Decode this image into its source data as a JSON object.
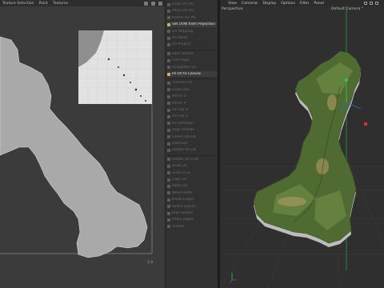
{
  "uv_editor": {
    "menu": [
      "Texture Selection",
      "Paint",
      "Textures"
    ],
    "axis_max_label": "1.0"
  },
  "commands": {
    "active_items": [
      {
        "label": "Set UVW from Projection"
      },
      {
        "label": "Fit UV to Canvas"
      }
    ],
    "dim_items": [
      "Scale UV Pts",
      "Move UV Pts",
      "Rotate UV Pts",
      "UV Mapping",
      "UV Relax",
      "UV Project",
      "Pack Islands",
      "Grid Align",
      "Straighten UV",
      "Transfer UV",
      "Scale UVs",
      "Mirror U",
      "Mirror V",
      "UV Flip U",
      "UV Flip V",
      "Fit Selection",
      "Align Islands",
      "Orient Islands",
      "Optimize",
      "Rotate 90 CW",
      "Rotate 90 CCW",
      "Scale 2x",
      "Scale 0.5x",
      "Copy UV",
      "Paste UV",
      "Weld Points",
      "Break Edges",
      "Select Seams",
      "Hide Seams",
      "Relax Edges",
      "Unfold"
    ]
  },
  "viewport": {
    "menu": [
      "View",
      "Cameras",
      "Display",
      "Options",
      "Filter",
      "Panel"
    ],
    "view_label": "Perspective",
    "camera_label": "Default Camera °"
  },
  "colors": {
    "uv_shape": "#a9a9a9",
    "uv_bg": "#3b3b3b",
    "terrain_green": "#4f6b32",
    "axis_green": "#2ecc40",
    "axis_blue": "#2a6bd8",
    "marker_red": "#d9342b"
  },
  "icons": [
    "uv-toolbar-icon",
    "viewport-icon",
    "checker-texture-icon"
  ]
}
